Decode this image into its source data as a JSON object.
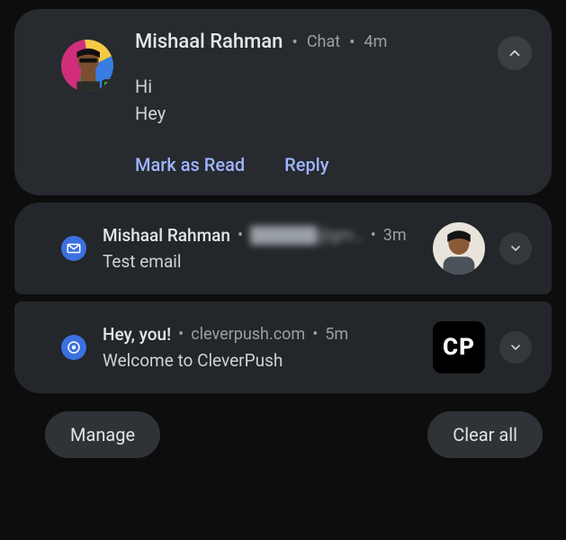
{
  "chat": {
    "sender": "Mishaal Rahman",
    "app": "Chat",
    "time": "4m",
    "messages": [
      "Hi",
      "Hey"
    ],
    "actions": {
      "mark_read": "Mark as Read",
      "reply": "Reply"
    }
  },
  "email": {
    "sender": "Mishaal Rahman",
    "address_obscured": "██████@gm…",
    "time": "3m",
    "subject": "Test email"
  },
  "push": {
    "title": "Hey, you!",
    "source": "cleverpush.com",
    "time": "5m",
    "body": "Welcome to CleverPush",
    "thumb_text": "CP"
  },
  "footer": {
    "manage": "Manage",
    "clear": "Clear all"
  }
}
